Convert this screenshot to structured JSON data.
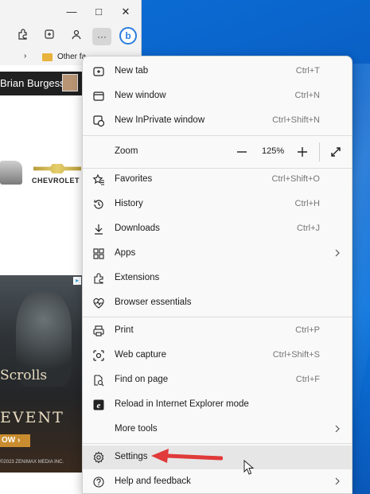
{
  "browser": {
    "window_controls": {
      "minimize": "—",
      "maximize": "□",
      "close": "✕"
    },
    "toolbar_icons": [
      "extensions-icon",
      "collections-icon",
      "profile-icon",
      "more-icon",
      "bing-icon"
    ],
    "more_label": "···",
    "bing_label": "b",
    "favorites_bar": {
      "folder_label": "Other fa"
    },
    "page": {
      "user_name": "Brian Burgess",
      "brand_text": "CHEVROLET",
      "ad": {
        "title_fragment": "Scrolls",
        "event_fragment": "EVENT",
        "cta_fragment": "OW ›",
        "legal": "©2023 ZENIMAX MEDIA INC."
      }
    }
  },
  "menu": {
    "groups": [
      [
        {
          "name": "new-tab",
          "icon": "new-tab-icon",
          "label": "New tab",
          "shortcut": "Ctrl+T"
        },
        {
          "name": "new-window",
          "icon": "new-window-icon",
          "label": "New window",
          "shortcut": "Ctrl+N"
        },
        {
          "name": "new-inprivate-window",
          "icon": "inprivate-icon",
          "label": "New InPrivate window",
          "shortcut": "Ctrl+Shift+N"
        }
      ]
    ],
    "zoom": {
      "label": "Zoom",
      "value": "125%",
      "minus": "−",
      "plus": "+"
    },
    "items": {
      "favorites": {
        "label": "Favorites",
        "shortcut": "Ctrl+Shift+O"
      },
      "history": {
        "label": "History",
        "shortcut": "Ctrl+H"
      },
      "downloads": {
        "label": "Downloads",
        "shortcut": "Ctrl+J"
      },
      "apps": {
        "label": "Apps"
      },
      "extensions": {
        "label": "Extensions"
      },
      "browser_essentials": {
        "label": "Browser essentials"
      },
      "print": {
        "label": "Print",
        "shortcut": "Ctrl+P"
      },
      "web_capture": {
        "label": "Web capture",
        "shortcut": "Ctrl+Shift+S"
      },
      "find_on_page": {
        "label": "Find on page",
        "shortcut": "Ctrl+F"
      },
      "ie_mode": {
        "label": "Reload in Internet Explorer mode"
      },
      "more_tools": {
        "label": "More tools"
      },
      "settings": {
        "label": "Settings"
      },
      "help": {
        "label": "Help and feedback"
      }
    },
    "highlight_color": "#e6e6e6"
  },
  "annotation": {
    "arrow_color": "#e03a3a"
  }
}
